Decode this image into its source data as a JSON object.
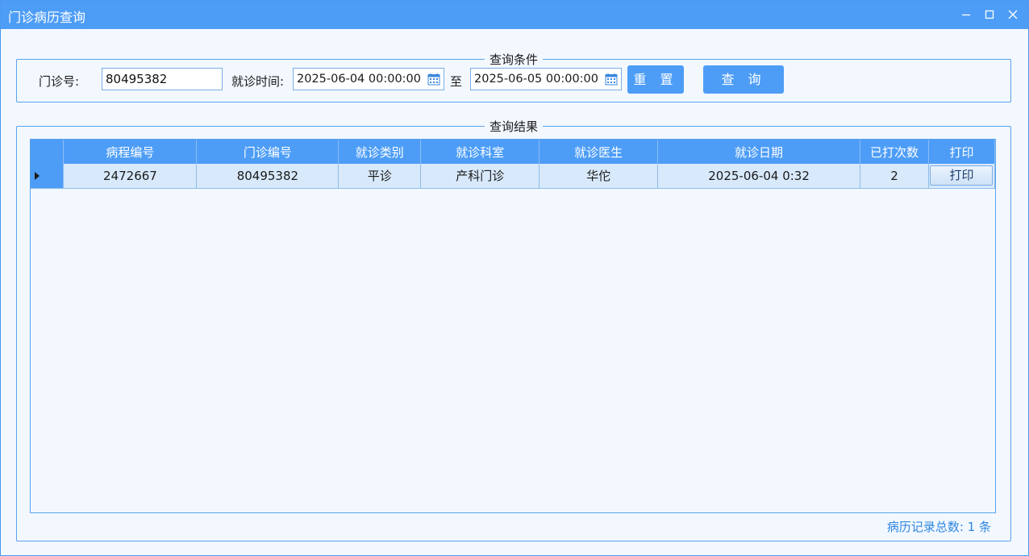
{
  "window": {
    "title": "门诊病历查询"
  },
  "filter": {
    "legend": "查询条件",
    "clinic_no_label": "门诊号:",
    "clinic_no_value": "80495382",
    "visit_time_label": "就诊时间:",
    "start_date": "2025-06-04 00:00:00",
    "to_label": "至",
    "end_date": "2025-06-05 00:00:00",
    "reset_label": "重 置",
    "query_label": "查 询"
  },
  "results": {
    "legend": "查询结果",
    "columns": [
      "病程编号",
      "门诊编号",
      "就诊类别",
      "就诊科室",
      "就诊医生",
      "就诊日期",
      "已打次数",
      "打印"
    ],
    "rows": [
      {
        "case_no": "2472667",
        "clinic_no": "80495382",
        "visit_type": "平诊",
        "department": "产科门诊",
        "doctor": "华佗",
        "visit_date": "2025-06-04 0:32",
        "print_count": "2",
        "print_button": "打印"
      }
    ],
    "total_text": "病历记录总数: 1 条"
  },
  "colors": {
    "accent": "#4d9df7",
    "row_bg": "#d8e9fb",
    "background": "#f3f8ff",
    "count_text": "#2e86e0"
  },
  "icons": [
    "minimize-icon",
    "maximize-icon",
    "close-icon",
    "calendar-icon",
    "row-pointer-icon"
  ]
}
